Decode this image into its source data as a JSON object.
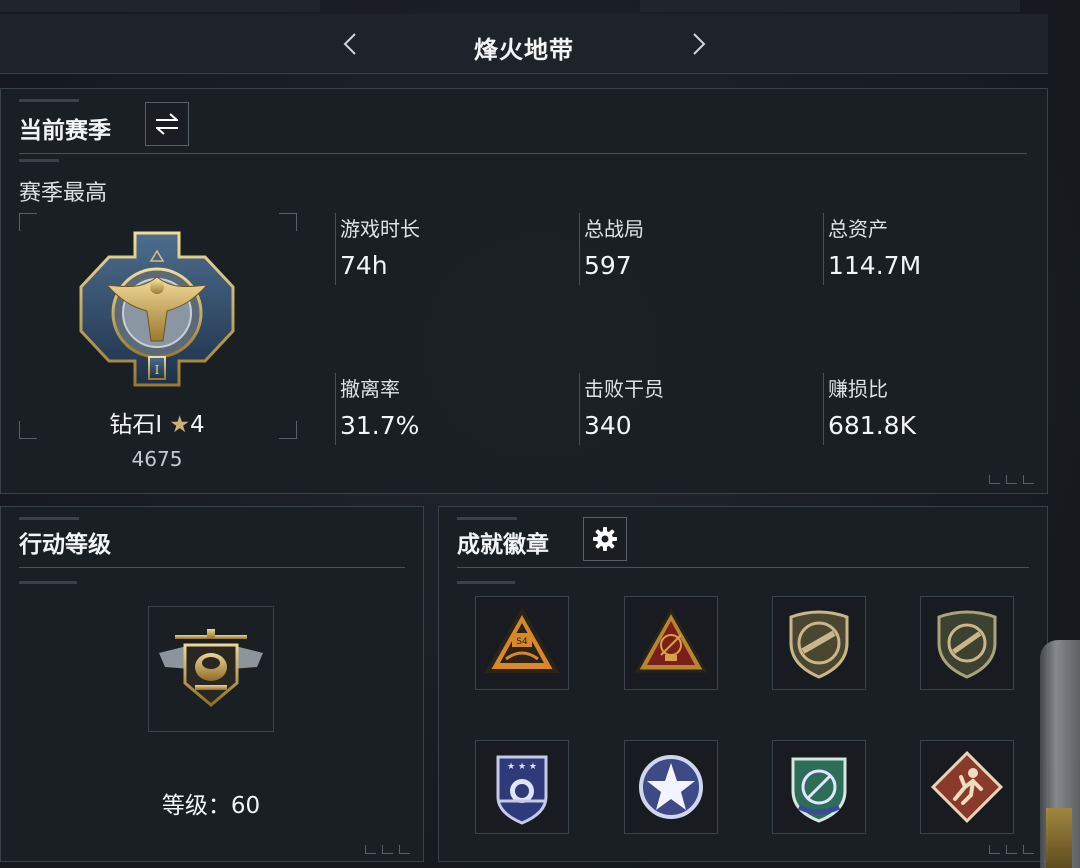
{
  "header": {
    "title": "烽火地带",
    "prev_icon": "chevron-left-icon",
    "next_icon": "chevron-right-icon"
  },
  "season": {
    "title": "当前赛季",
    "switch_icon": "swap-arrows-icon",
    "subtitle": "赛季最高",
    "rank_name": "钻石I",
    "rank_stars": "4",
    "rank_points": "4675",
    "rank_emblem_icon": "diamond-eagle-emblem-icon",
    "stats": [
      {
        "label": "游戏时长",
        "value": "74h"
      },
      {
        "label": "总战局",
        "value": "597"
      },
      {
        "label": "总资产",
        "value": "114.7M"
      },
      {
        "label": "撤离率",
        "value": "31.7%"
      },
      {
        "label": "击败干员",
        "value": "340"
      },
      {
        "label": "赚损比",
        "value": "681.8K"
      }
    ]
  },
  "operation_level": {
    "title": "行动等级",
    "level_text": "等级：60",
    "emblem_icon": "helicopter-emblem-icon"
  },
  "achievements": {
    "title": "成就徽章",
    "settings_icon": "gear-icon",
    "badges": [
      {
        "name": "s4-season-badge-icon"
      },
      {
        "name": "radar-triangle-badge-icon"
      },
      {
        "name": "rifle-shield-badge-icon"
      },
      {
        "name": "rifle-circle-badge-icon"
      },
      {
        "name": "blue-shield-badge-icon"
      },
      {
        "name": "star-circle-badge-icon"
      },
      {
        "name": "compass-shield-badge-icon"
      },
      {
        "name": "runner-diamond-badge-icon"
      }
    ]
  },
  "colors": {
    "background": "#1b1f24",
    "panel_border": "#3b4148",
    "text": "#f2f4f6",
    "gold": "#c8b27a"
  }
}
